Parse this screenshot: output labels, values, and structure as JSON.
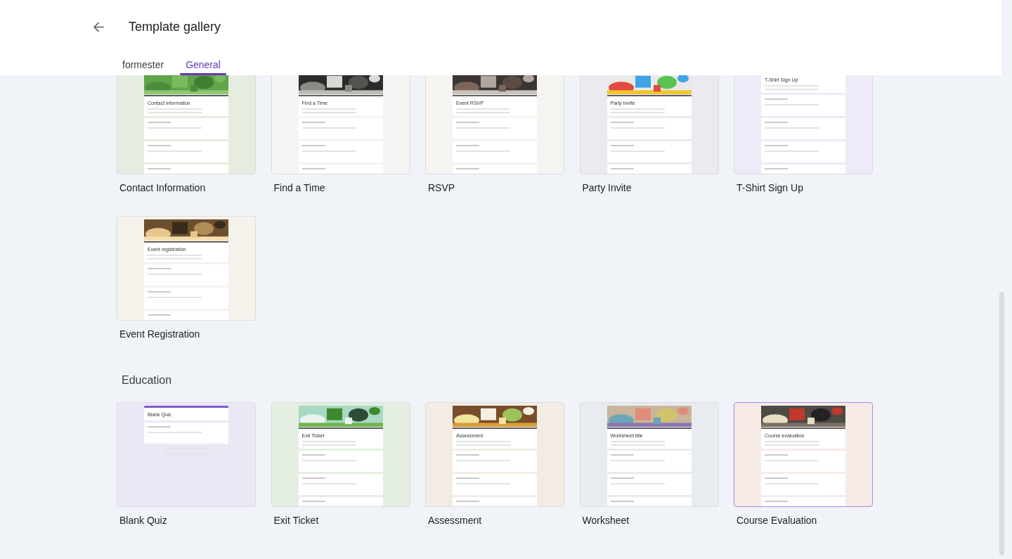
{
  "header": {
    "title": "Template gallery"
  },
  "tabs": [
    {
      "label": "formester",
      "selected": false
    },
    {
      "label": "General",
      "selected": true
    }
  ],
  "sections": [
    {
      "templates": [
        {
          "name": "Contact Information",
          "title": "Contact information",
          "color": "#e4ede0",
          "selected": false
        },
        {
          "name": "Find a Time",
          "title": "Find a Time",
          "color": "#f4f4f4",
          "selected": false
        },
        {
          "name": "RSVP",
          "title": "Event RSVP",
          "color": "#f6f4f1",
          "selected": false
        },
        {
          "name": "Party Invite",
          "title": "Party Invite",
          "color": "#ebeaef",
          "selected": false
        },
        {
          "name": "T-Shirt Sign Up",
          "title": "T-Shirt Sign Up",
          "kind": "plain",
          "color": "#eeeaf7",
          "selected": false
        },
        {
          "name": "Event Registration",
          "title": "Event registration",
          "color": "#f6f2ec",
          "selected": false
        }
      ]
    },
    {
      "heading": "Education",
      "templates": [
        {
          "name": "Blank Quiz",
          "title": "Blank Quiz",
          "kind": "blank",
          "color": "#ebe7f5",
          "selected": false
        },
        {
          "name": "Exit Ticket",
          "title": "Exit Ticket",
          "color": "#e4efe2",
          "selected": false
        },
        {
          "name": "Assessment",
          "title": "Assessment",
          "color": "#f3ece4",
          "selected": false
        },
        {
          "name": "Worksheet",
          "title": "Worksheet title",
          "color": "#e8ecf0",
          "selected": false
        },
        {
          "name": "Course Evaluation",
          "title": "Course evaluation",
          "color": "#f6ebe7",
          "selected": true
        }
      ]
    }
  ]
}
